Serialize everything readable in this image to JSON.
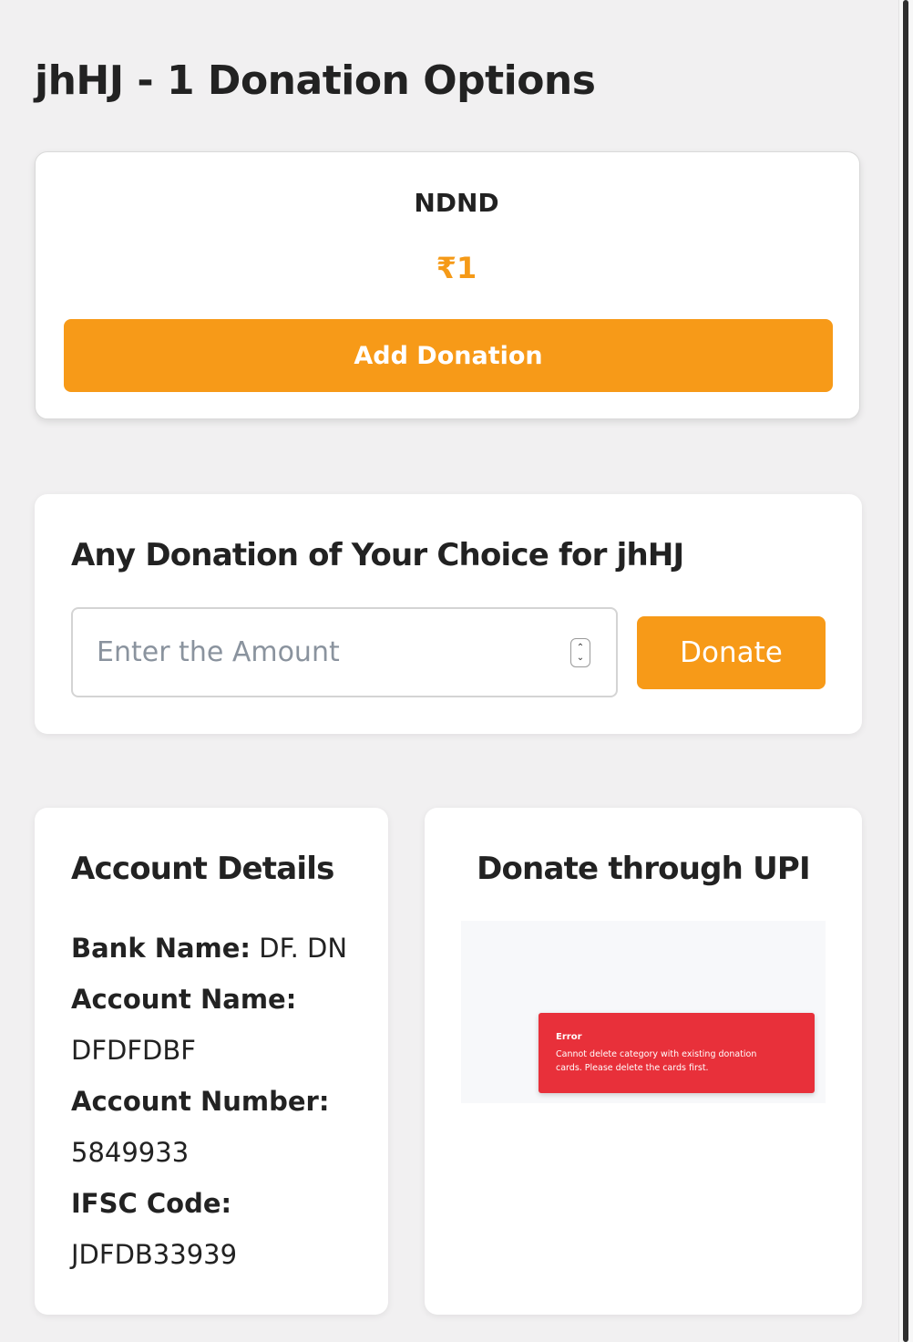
{
  "page": {
    "title": "jhHJ - 1 Donation Options"
  },
  "donation_option": {
    "name": "NDND",
    "amount": "₹1",
    "button_label": "Add Donation"
  },
  "custom_donation": {
    "heading": "Any Donation of Your Choice for jhHJ",
    "amount_placeholder": "Enter the Amount",
    "amount_value": "",
    "donate_label": "Donate"
  },
  "account_details": {
    "heading": "Account Details",
    "bank_name_label": "Bank Name:",
    "bank_name_value": "DF. DN",
    "account_name_label": "Account Name:",
    "account_name_value": "DFDFDBF",
    "account_number_label": "Account Number:",
    "account_number_value": "5849933",
    "ifsc_label": "IFSC Code:",
    "ifsc_value": "JDFDB33939"
  },
  "upi": {
    "heading": "Donate through UPI",
    "image_error_title": "Error",
    "image_error_message": "Cannot delete category with existing donation cards. Please delete the cards first."
  },
  "colors": {
    "accent": "#f79a18",
    "amount_text": "#f59a18",
    "page_background": "#f1f0f1",
    "card_background": "#ffffff",
    "error_background": "#e8303a"
  },
  "icons": {
    "number_stepper": "number-stepper-icon"
  }
}
